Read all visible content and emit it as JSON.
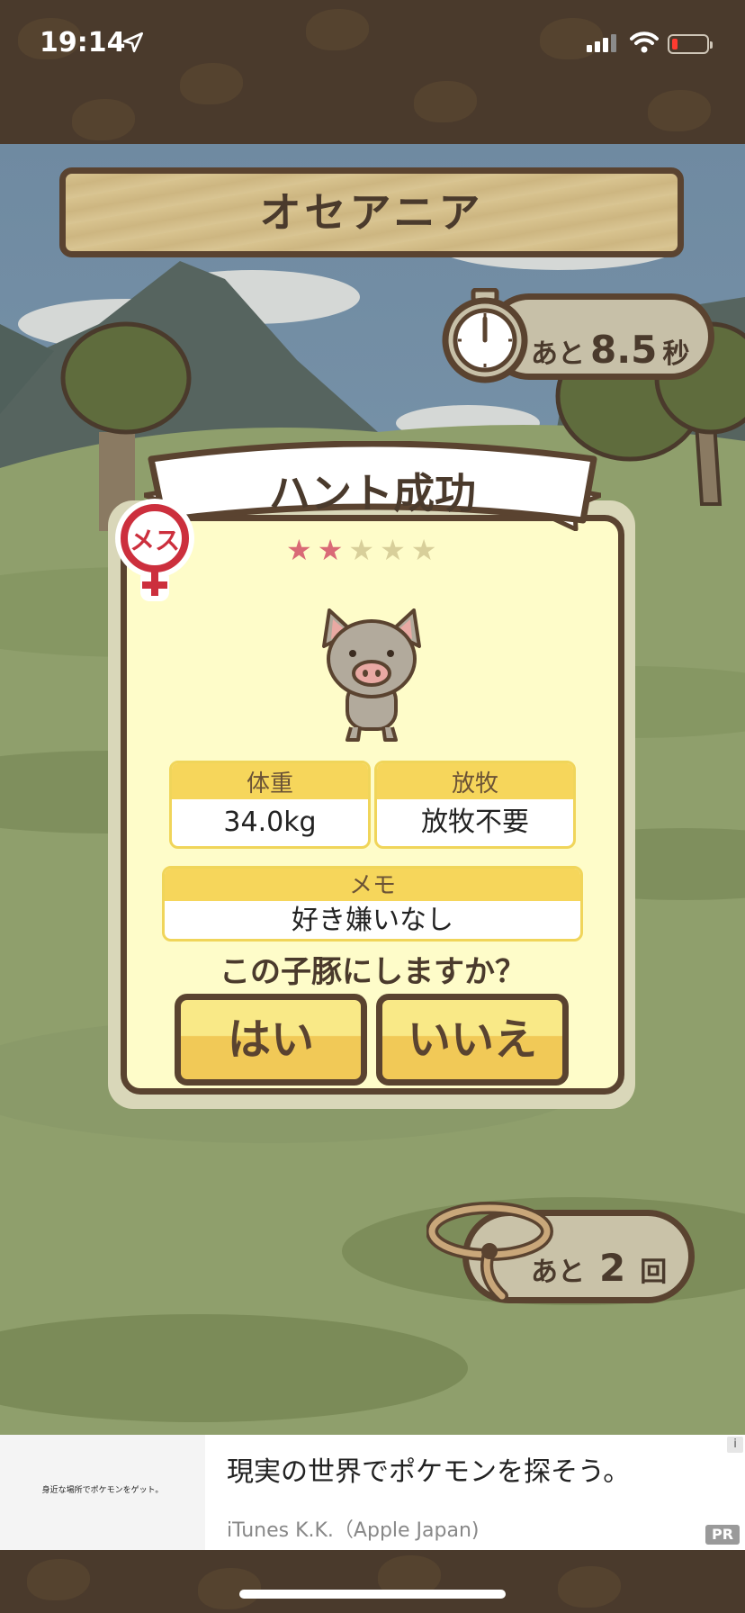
{
  "status_bar": {
    "time": "19:14"
  },
  "location": {
    "name": "オセアニア"
  },
  "timer": {
    "prefix": "あと",
    "value": "8.5",
    "unit": "秒"
  },
  "result": {
    "title": "ハント成功",
    "stars_filled": 2,
    "stars_total": 5,
    "gender_label": "メス",
    "weight": {
      "label": "体重",
      "value": "34.0kg"
    },
    "pasture": {
      "label": "放牧",
      "value": "放牧不要"
    },
    "memo": {
      "label": "メモ",
      "value": "好き嫌いなし"
    },
    "question": "この子豚にしますか？",
    "yes_label": "はい",
    "no_label": "いいえ"
  },
  "attempts": {
    "prefix": "あと",
    "value": "2",
    "unit": "回"
  },
  "ad": {
    "thumb_text": "身近な場所でポケモンをゲット。",
    "title": "現実の世界でポケモンを探そう。",
    "advertiser": "iTunes K.K.（Apple Japan)",
    "badge": "PR",
    "info": "i"
  },
  "colors": {
    "brown": "#5a4330",
    "card_bg": "#fefcc9",
    "button_yellow": "#f1c957",
    "star_on": "#d96a76"
  }
}
